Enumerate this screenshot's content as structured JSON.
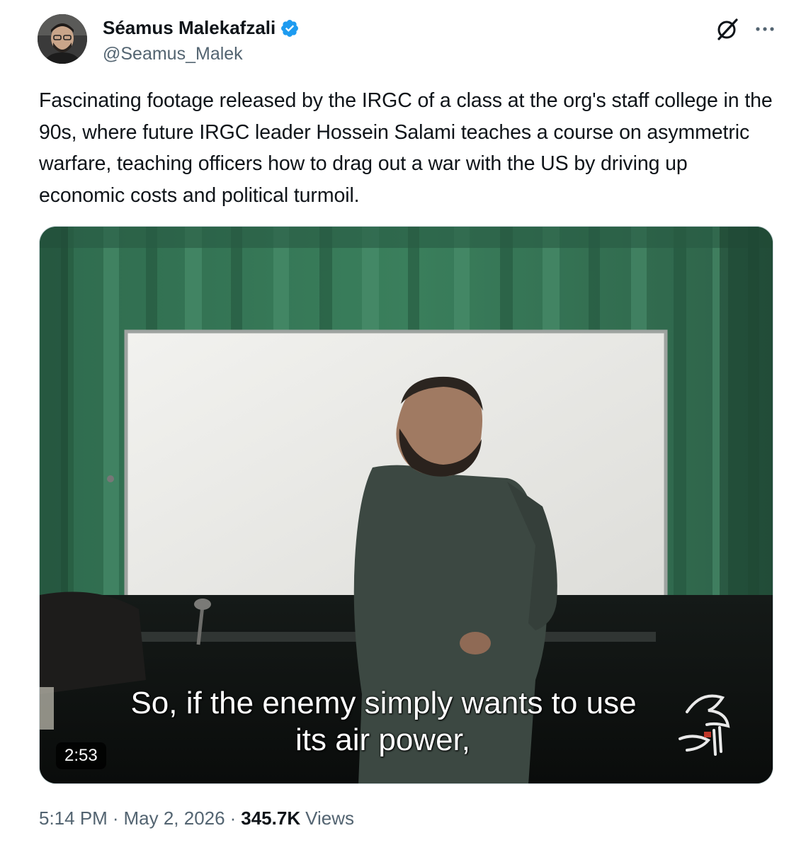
{
  "author": {
    "display_name": "Séamus Malekafzali",
    "handle": "@Seamus_Malek",
    "verified": true
  },
  "colors": {
    "accent": "#1d9bf0",
    "text_primary": "#0f1419",
    "text_secondary": "#536471",
    "border": "#cfd9de"
  },
  "icons": {
    "verified": "verified-badge-icon",
    "grok": "grok-icon",
    "more": "more-options-icon"
  },
  "tweet": {
    "text": "Fascinating footage released by the IRGC of a class at the org's staff college in the 90s, where future IRGC leader Hossein Salami teaches a course on asymmetric warfare, teaching officers how to drag out a war with the US by driving up economic costs and political turmoil."
  },
  "video": {
    "duration": "2:53",
    "subtitle_line1": "So, if the enemy simply wants to use",
    "subtitle_line2": "its air power,"
  },
  "meta": {
    "time": "5:14 PM",
    "date": "May 2, 2026",
    "separator": "·",
    "views_count": "345.7K",
    "views_label": "Views"
  }
}
